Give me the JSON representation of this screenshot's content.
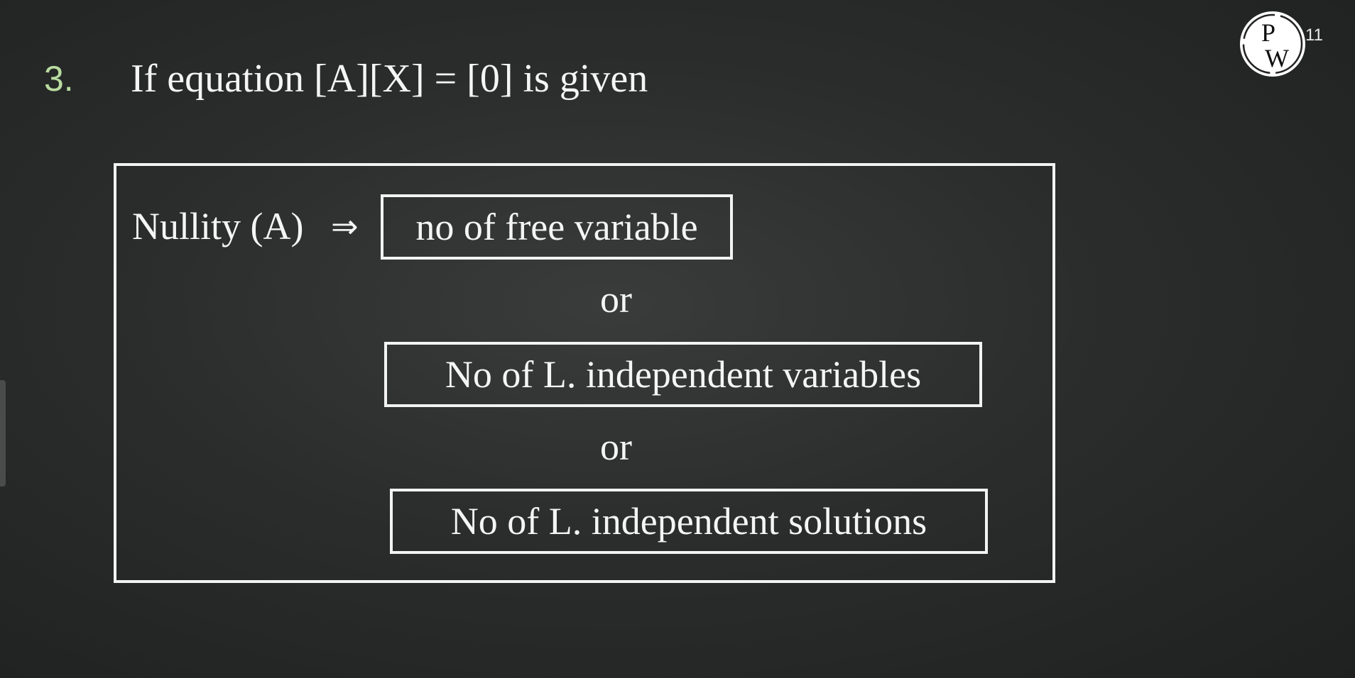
{
  "question": {
    "number": "3.",
    "text": "If equation [A][X] = [0] is given"
  },
  "header": {
    "logo_top": "P",
    "logo_bottom": "W",
    "slide_number": "11"
  },
  "content": {
    "label": "Nullity (A)",
    "implies_symbol": "⇒",
    "definitions": [
      "no of free variable",
      "No of L. independent variables",
      "No of L. independent solutions"
    ],
    "separator": "or"
  },
  "colors": {
    "background": "#2b2d2d",
    "text": "#f5f5f5",
    "question_number": "#b9dca0"
  }
}
